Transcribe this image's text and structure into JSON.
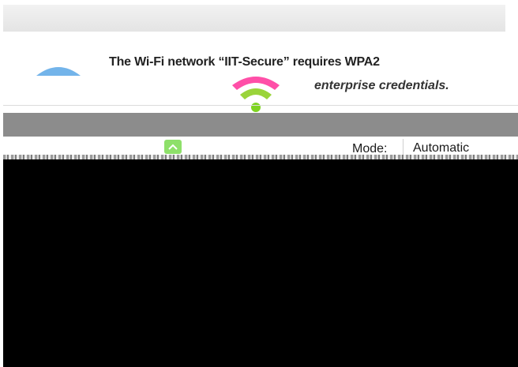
{
  "dialog": {
    "headline": "The Wi-Fi network “IIT-Secure” requires WPA2",
    "subline": "enterprise credentials."
  },
  "form": {
    "mode_label": "Mode:",
    "mode_value": "Automatic"
  },
  "icons": {
    "wifi": "wifi-icon",
    "toggle": "chevron-up-icon"
  },
  "colors": {
    "wifi_top": "#ff4fa8",
    "wifi_bottom": "#7ed321",
    "band": "#8c8c8c",
    "toggle": "#8ee06a"
  }
}
